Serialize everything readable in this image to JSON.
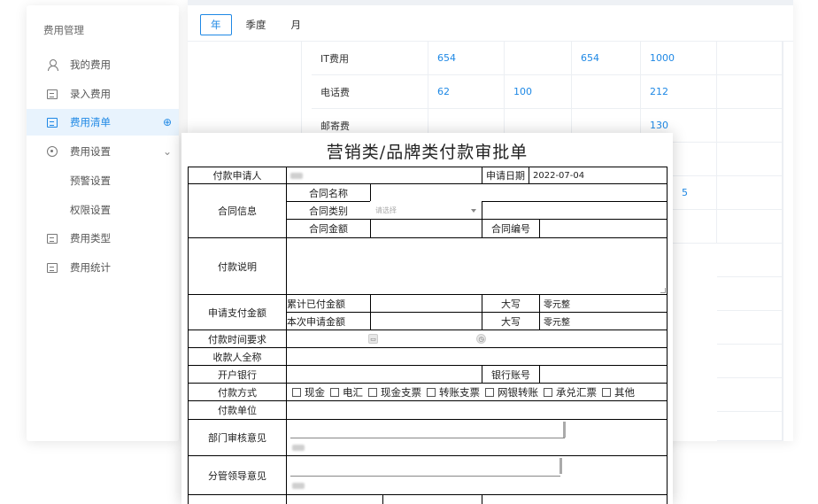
{
  "sidebar": {
    "title": "费用管理",
    "items": [
      {
        "label": "我的费用",
        "icon": "user-icon"
      },
      {
        "label": "录入费用",
        "icon": "edit-doc-icon"
      },
      {
        "label": "费用清单",
        "icon": "list-icon",
        "extra": "⊕"
      },
      {
        "label": "费用设置",
        "icon": "gear-icon",
        "extra": "⌄"
      },
      {
        "label": "预警设置"
      },
      {
        "label": "权限设置"
      },
      {
        "label": "费用类型",
        "icon": "type-icon"
      },
      {
        "label": "费用统计",
        "icon": "stats-icon"
      }
    ]
  },
  "tabs": [
    "年",
    "季度",
    "月"
  ],
  "table": {
    "rows": [
      {
        "name": "IT费用",
        "c1": "654",
        "c2": "",
        "c3": "654",
        "c4": "1000"
      },
      {
        "name": "电话费",
        "c1": "62",
        "c2": "100",
        "c3": "",
        "c4": "212"
      },
      {
        "name": "邮寄费",
        "c1": "",
        "c2": "",
        "c3": "",
        "c4": "130"
      }
    ],
    "peek_value": "5"
  },
  "form": {
    "title": "营销类/品牌类付款审批单",
    "applicant_label": "付款申请人",
    "apply_date_label": "申请日期",
    "apply_date_value": "2022-07-04",
    "contract_info_label": "合同信息",
    "contract_name_label": "合同名称",
    "contract_type_label": "合同类别",
    "contract_type_placeholder": "请选择",
    "contract_amount_label": "合同金额",
    "contract_no_label": "合同编号",
    "payment_desc_label": "付款说明",
    "request_amount_label": "申请支付金额",
    "paid_total_label": "累计已付金额",
    "current_request_label": "本次申请金额",
    "uppercase_label": "大写",
    "paid_uppercase_value": "零元整",
    "current_uppercase_value": "零元整",
    "pay_time_label": "付款时间要求",
    "payee_label": "收款人全称",
    "bank_label": "开户银行",
    "account_label": "银行账号",
    "pay_method_label": "付款方式",
    "pay_methods": [
      "现金",
      "电汇",
      "现金支票",
      "转账支票",
      "网银转账",
      "承兑汇票",
      "其他"
    ],
    "pay_unit_label": "付款单位",
    "dept_review_label": "部门审核意见",
    "leader_review_label": "分管领导意见"
  }
}
